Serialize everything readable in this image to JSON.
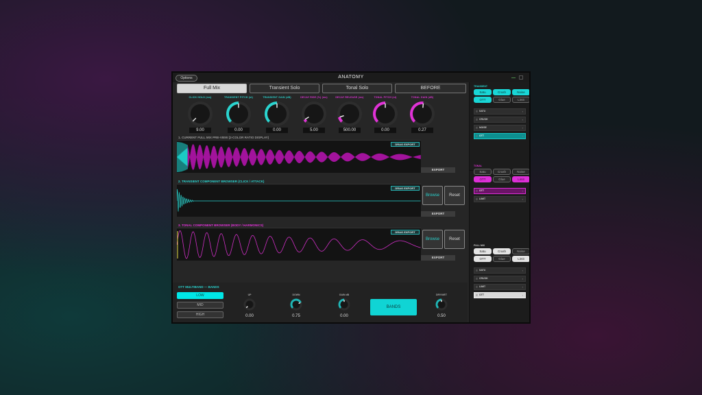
{
  "window": {
    "title": "ANATOMY",
    "options_label": "Options"
  },
  "tabs": [
    {
      "label": "Full Mix",
      "active": true
    },
    {
      "label": "Transient Solo",
      "active": false
    },
    {
      "label": "Tonal Solo",
      "active": false
    },
    {
      "label": "BEFORE",
      "active": false
    }
  ],
  "knobs": [
    {
      "label": "CLICK HOLD (ms)",
      "value": "9.00",
      "fraction": 0.0,
      "color": "#2ad4cf"
    },
    {
      "label": "TRANSIENT PITCH (st)",
      "value": "0.00",
      "fraction": 0.5,
      "color": "#2ad4cf"
    },
    {
      "label": "TRANSIENT GAIN (dB)",
      "value": "0.00",
      "fraction": 0.5,
      "color": "#2ad4cf"
    },
    {
      "label": "DECAY RISE (%) (ms)",
      "value": "5.00",
      "fraction": 0.05,
      "color": "#e032d6"
    },
    {
      "label": "DECAY RELEASE (ms)",
      "value": "500.00",
      "fraction": 0.1,
      "color": "#e032d6"
    },
    {
      "label": "TONAL PITCH (st)",
      "value": "0.00",
      "fraction": 0.5,
      "color": "#e032d6"
    },
    {
      "label": "TONAL GAIN (dB)",
      "value": "0.27",
      "fraction": 0.52,
      "color": "#e032d6"
    }
  ],
  "sections": {
    "mix": {
      "title": "1. CURRENT FULL MIX PRE-VIEW (2-COLOR RATIO DISPLAY)",
      "drag_label": "DRAG EXPORT",
      "export_label": "EXPORT"
    },
    "transient": {
      "title": "2. TRANSIENT COMPONENT BROWSER (CLICK / ATTACK)",
      "drag_label": "DRAG EXPORT",
      "export_label": "EXPORT",
      "browse_label": "Browse",
      "reset_label": "Reset"
    },
    "tonal": {
      "title": "3. TONAL COMPONENT BROWSER (BODY / HARMONICS)",
      "drag_label": "DRAG EXPORT",
      "export_label": "EXPORT",
      "browse_label": "Browse",
      "reset_label": "Reset"
    }
  },
  "ott": {
    "title": "OTT MULTIBAND — BANDS",
    "bands": [
      {
        "label": "LOW",
        "active": true
      },
      {
        "label": "MID",
        "active": false
      },
      {
        "label": "HIGH",
        "active": false
      }
    ],
    "knobs": [
      {
        "label": "UP",
        "value": "0.00",
        "fraction": 0.0,
        "color": "#ffffff"
      },
      {
        "label": "DOWN",
        "value": "0.75",
        "fraction": 0.75,
        "color": "#1fb6b6"
      },
      {
        "label": "GAIN dB",
        "value": "0.00",
        "fraction": 0.5,
        "color": "#1fb6b6"
      },
      {
        "label": "DRY/WET",
        "value": "0.50",
        "fraction": 0.5,
        "color": "#1fb6b6"
      }
    ],
    "bands_button": "BANDS"
  },
  "sidebar": {
    "transient": {
      "heading": "TRANSIENT",
      "chips": [
        {
          "label": "Satu",
          "on": true
        },
        {
          "label": "Crush",
          "on": true
        },
        {
          "label": "Noise",
          "on": true
        },
        {
          "label": "OTT",
          "on": true
        },
        {
          "label": "Glue",
          "on": false
        },
        {
          "label": "Limit",
          "on": false
        }
      ],
      "chain": [
        {
          "label": "SATU",
          "selected": false
        },
        {
          "label": "CRUSH",
          "selected": false
        },
        {
          "label": "NOISE",
          "selected": false
        },
        {
          "label": "OTT",
          "selected": true
        }
      ]
    },
    "tonal": {
      "heading": "TONAL",
      "chips": [
        {
          "label": "Satu",
          "on": false
        },
        {
          "label": "Crush",
          "on": false
        },
        {
          "label": "Noise",
          "on": false
        },
        {
          "label": "OTT",
          "on": true
        },
        {
          "label": "Glue",
          "on": false
        },
        {
          "label": "Limit",
          "on": true
        }
      ],
      "chain": [
        {
          "label": "OTT",
          "selected": true
        },
        {
          "label": "LIMIT",
          "selected": false
        }
      ]
    },
    "fullmix": {
      "heading": "FULL MIX",
      "chips": [
        {
          "label": "Satu",
          "on": true
        },
        {
          "label": "Crush",
          "on": true
        },
        {
          "label": "Noise",
          "on": false
        },
        {
          "label": "OTT",
          "on": true
        },
        {
          "label": "Glue",
          "on": false
        },
        {
          "label": "Limit",
          "on": true
        }
      ],
      "chain": [
        {
          "label": "SATU",
          "selected": false
        },
        {
          "label": "CRUSH",
          "selected": false
        },
        {
          "label": "LIMIT",
          "selected": false
        },
        {
          "label": "OTT",
          "selected": true
        }
      ]
    }
  },
  "colors": {
    "cyan": "#2ad4cf",
    "pink": "#e032d6",
    "panel": "#262626"
  }
}
